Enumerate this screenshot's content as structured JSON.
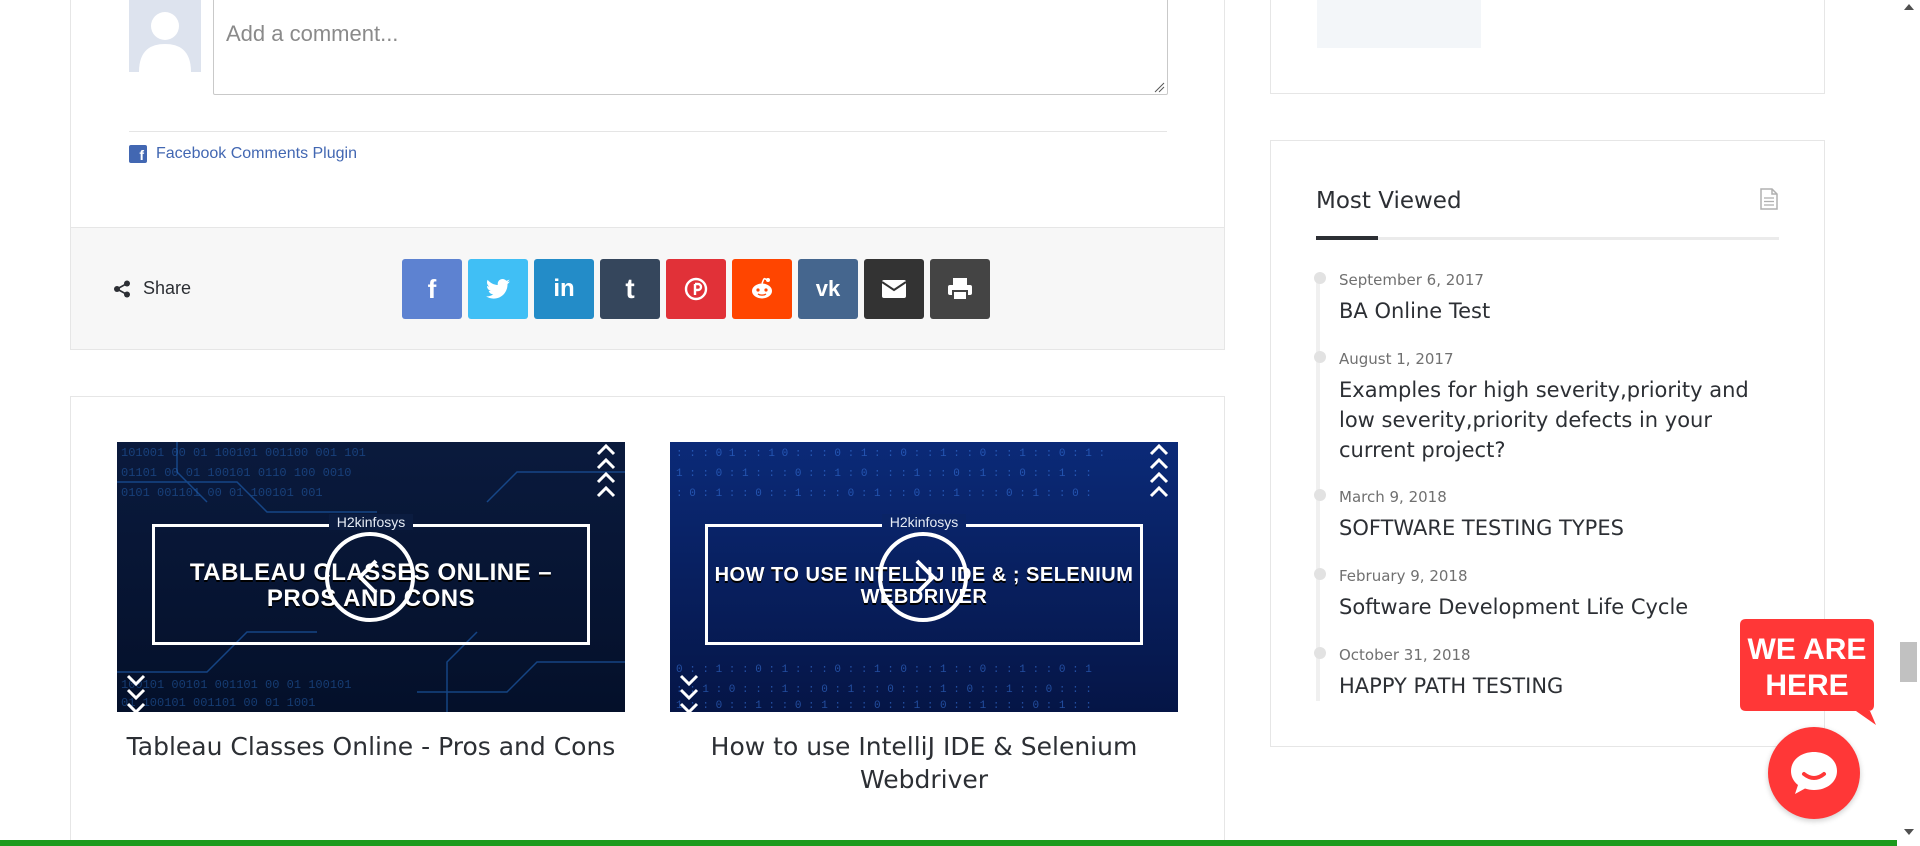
{
  "comments": {
    "placeholder": "Add a comment...",
    "plugin_label": "Facebook Comments Plugin",
    "plugin_icon": "facebook-icon"
  },
  "share": {
    "label": "Share",
    "label_icon": "share-icon",
    "buttons": [
      {
        "name": "facebook",
        "icon": "facebook-icon",
        "glyph": "f",
        "color": "#5d82d1"
      },
      {
        "name": "twitter",
        "icon": "twitter-icon",
        "glyph": "🐦",
        "color": "#40bff5"
      },
      {
        "name": "linkedin",
        "icon": "linkedin-icon",
        "glyph": "in",
        "color": "#238cc8"
      },
      {
        "name": "tumblr",
        "icon": "tumblr-icon",
        "glyph": "t",
        "color": "#35465c"
      },
      {
        "name": "pinterest",
        "icon": "pinterest-icon",
        "glyph": "P",
        "color": "#e13138"
      },
      {
        "name": "reddit",
        "icon": "reddit-icon",
        "glyph": "●",
        "color": "#ff4500"
      },
      {
        "name": "vk",
        "icon": "vk-icon",
        "glyph": "vk",
        "color": "#45668e"
      },
      {
        "name": "email",
        "icon": "envelope-icon",
        "glyph": "✉",
        "color": "#333333"
      },
      {
        "name": "print",
        "icon": "printer-icon",
        "glyph": "⎙",
        "color": "#444444"
      }
    ]
  },
  "related": [
    {
      "brand": "H2kinfosys",
      "headline": "Tableau Classes Online – Pros and Cons",
      "title": "Tableau Classes Online - Pros and Cons",
      "nav_icon": "chevron-left-icon"
    },
    {
      "brand": "H2kinfosys",
      "headline": "How to use IntelliJ IDE & ; Selenium Webdriver",
      "title": "How to use IntelliJ IDE & Selenium Webdriver",
      "nav_icon": "chevron-right-icon"
    }
  ],
  "most_viewed": {
    "title": "Most Viewed",
    "icon": "document-icon",
    "items": [
      {
        "date": "September 6, 2017",
        "title": "BA Online Test"
      },
      {
        "date": "August 1, 2017",
        "title": "Examples for high severity,priority and low severity,priority defects in your current project?"
      },
      {
        "date": "March 9, 2018",
        "title": "SOFTWARE TESTING TYPES"
      },
      {
        "date": "February 9, 2018",
        "title": "Software Development Life Cycle"
      },
      {
        "date": "October 31, 2018",
        "title": "HAPPY PATH TESTING"
      }
    ]
  },
  "chat": {
    "badge_line1": "WE ARE",
    "badge_line2": "HERE",
    "icon": "chat-bubble-icon",
    "color": "#ff3737"
  },
  "colors": {
    "accent_green": "#1e9a1e",
    "text_dark": "#2c2f34",
    "facebook_blue": "#4267b2"
  }
}
